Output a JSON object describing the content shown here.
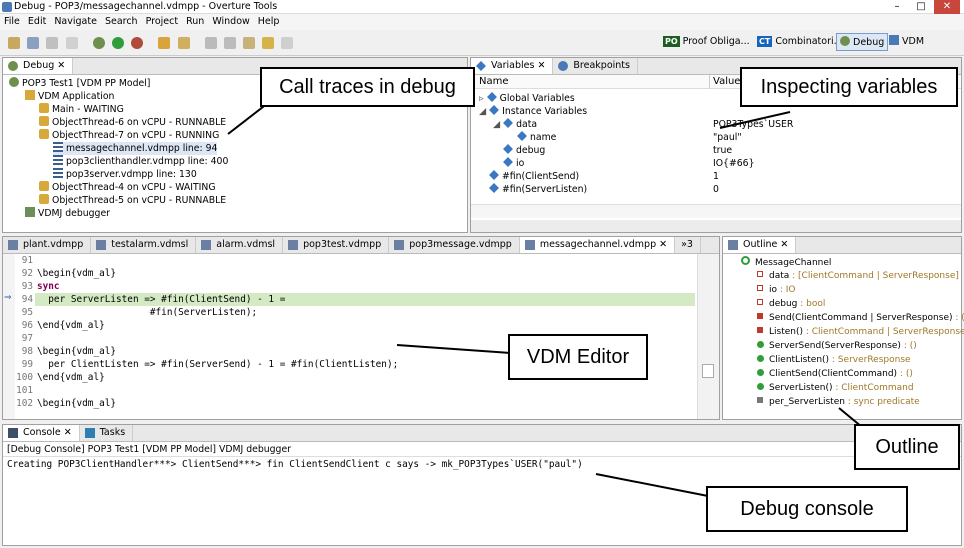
{
  "window": {
    "title": "Debug - POP3/messagechannel.vdmpp - Overture Tools",
    "min": "–",
    "max": "□",
    "close": "✕"
  },
  "menu": [
    "File",
    "Edit",
    "Navigate",
    "Search",
    "Project",
    "Run",
    "Window",
    "Help"
  ],
  "perspectives": [
    {
      "badge": "PO",
      "label": "Proof Obliga..."
    },
    {
      "badge": "CT",
      "label": "Combinatori..."
    },
    {
      "badge": "",
      "label": "Debug"
    },
    {
      "badge": "",
      "label": "VDM"
    }
  ],
  "debug_view": {
    "tab": "Debug",
    "tree": [
      "POP3 Test1 [VDM PP Model]",
      "VDM Application",
      "Main - WAITING",
      "ObjectThread-6 on vCPU - RUNNABLE",
      "ObjectThread-7 on vCPU - RUNNING",
      "messagechannel.vdmpp line: 94",
      "pop3clienthandler.vdmpp line: 400",
      "pop3server.vdmpp line: 130",
      "ObjectThread-4 on vCPU - WAITING",
      "ObjectThread-5 on vCPU - RUNNABLE",
      "VDMJ debugger"
    ]
  },
  "variables_view": {
    "tabs": [
      "Variables",
      "Breakpoints"
    ],
    "headers": [
      "Name",
      "Value"
    ],
    "rows": [
      {
        "name": "Global Variables",
        "value": ""
      },
      {
        "name": "Instance Variables",
        "value": ""
      },
      {
        "name": "data",
        "value": "POP3Types`USER"
      },
      {
        "name": "name",
        "value": "\"paul\""
      },
      {
        "name": "debug",
        "value": "true"
      },
      {
        "name": "io",
        "value": "IO{#66}"
      },
      {
        "name": "#fin(ClientSend)",
        "value": "1"
      },
      {
        "name": "#fin(ServerListen)",
        "value": "0"
      }
    ]
  },
  "editor": {
    "tabs": [
      "plant.vdmpp",
      "testalarm.vdmsl",
      "alarm.vdmsl",
      "pop3test.vdmpp",
      "pop3message.vdmpp",
      "messagechannel.vdmpp"
    ],
    "overflow": "»3",
    "lines": [
      {
        "n": "91",
        "text": ""
      },
      {
        "n": "92",
        "text": "\\begin{vdm_al}"
      },
      {
        "n": "93",
        "text": "sync"
      },
      {
        "n": "94",
        "text": "  per ServerListen => #fin(ClientSend) - 1 ="
      },
      {
        "n": "95",
        "text": "                    #fin(ServerListen);"
      },
      {
        "n": "96",
        "text": "\\end{vdm_al}"
      },
      {
        "n": "97",
        "text": ""
      },
      {
        "n": "98",
        "text": "\\begin{vdm_al}"
      },
      {
        "n": "99",
        "text": "  per ClientListen => #fin(ServerSend) - 1 = #fin(ClientListen);"
      },
      {
        "n": "100",
        "text": "\\end{vdm_al}"
      },
      {
        "n": "101",
        "text": ""
      },
      {
        "n": "102",
        "text": "\\begin{vdm_al}"
      }
    ]
  },
  "outline": {
    "tab": "Outline",
    "root": "MessageChannel",
    "items": [
      {
        "name": "data",
        "type": " : [ClientCommand | ServerResponse]"
      },
      {
        "name": "io",
        "type": " : IO"
      },
      {
        "name": "debug",
        "type": " : bool"
      },
      {
        "name": "Send(ClientCommand | ServerResponse)",
        "type": " : ()"
      },
      {
        "name": "Listen()",
        "type": " : ClientCommand | ServerResponse"
      },
      {
        "name": "ServerSend(ServerResponse)",
        "type": " : ()"
      },
      {
        "name": "ClientListen()",
        "type": " : ServerResponse"
      },
      {
        "name": "ClientSend(ClientCommand)",
        "type": " : ()"
      },
      {
        "name": "ServerListen()",
        "type": " : ClientCommand"
      },
      {
        "name": "per_ServerListen",
        "type": " : sync predicate"
      }
    ]
  },
  "console": {
    "tabs": [
      "Console",
      "Tasks"
    ],
    "header": "[Debug Console] POP3 Test1 [VDM PP Model] VDMJ debugger",
    "output": "Creating POP3ClientHandler***> ClientSend***> fin ClientSendClient c says -> mk_POP3Types`USER(\"paul\")"
  },
  "callouts": {
    "call_traces": "Call traces in debug",
    "variables": "Inspecting variables",
    "editor": "VDM Editor",
    "outline": "Outline",
    "console": "Debug console"
  }
}
